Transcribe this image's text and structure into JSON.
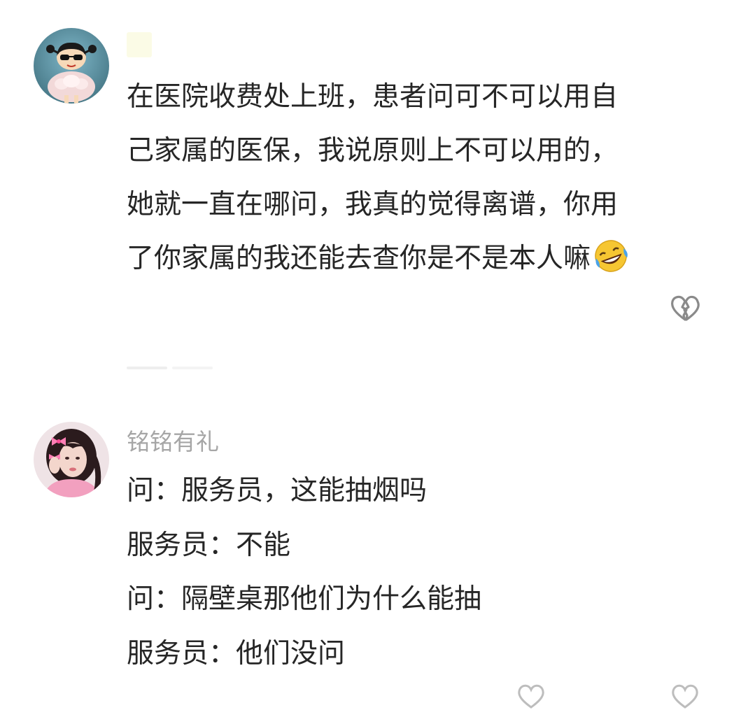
{
  "comments": [
    {
      "username": "",
      "avatar": "crayon-shinchan-sunglasses-avatar",
      "lines": [
        "在医院收费处上班，患者问可不可以用自",
        "己家属的医保，我说原则上不可以用的，",
        "她就一直在哪问，我真的觉得离谱，你用",
        "了你家属的我还能去查你是不是本人嘛"
      ],
      "trailing_emoji": "rolling-on-floor-laughing-emoji",
      "action_icon": "broken-heart-icon"
    },
    {
      "username": "铭铭有礼",
      "avatar": "girl-with-pink-bows-avatar",
      "lines": [
        "问：服务员，这能抽烟吗",
        "服务员：不能",
        "问：隔壁桌那他们为什么能抽",
        "服务员：他们没问"
      ]
    }
  ],
  "colors": {
    "text": "#262626",
    "username": "#a6a6a6",
    "icon": "#8a8a8a",
    "divider": "#eeeeee"
  }
}
